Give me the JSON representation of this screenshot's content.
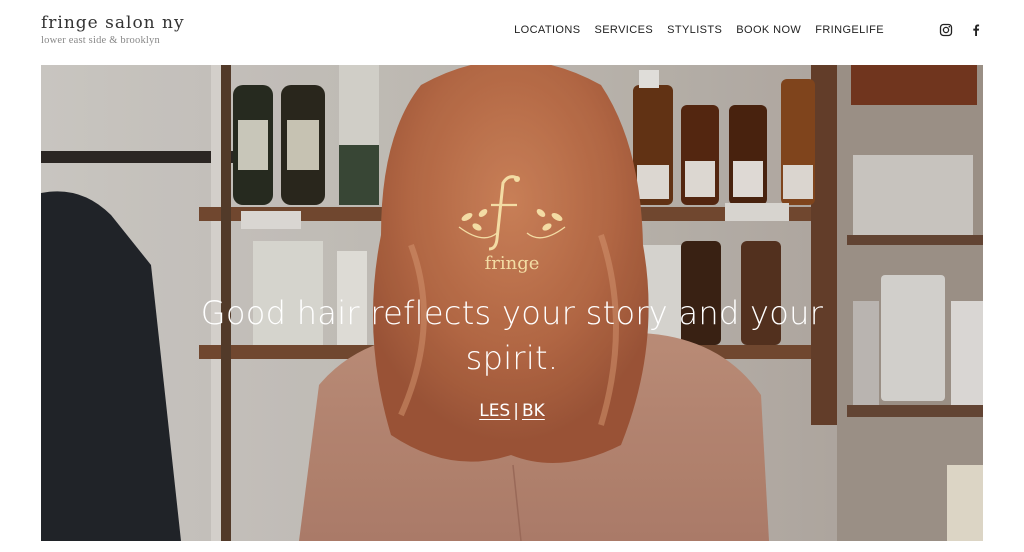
{
  "brand": {
    "title": "fringe salon ny",
    "subtitle": "lower east side & brooklyn"
  },
  "nav": {
    "items": [
      {
        "label": "LOCATIONS"
      },
      {
        "label": "SERVICES"
      },
      {
        "label": "STYLISTS"
      },
      {
        "label": "BOOK NOW"
      },
      {
        "label": "FRINGELIFE"
      }
    ]
  },
  "social": {
    "icons": [
      "instagram-icon",
      "facebook-icon"
    ]
  },
  "hero": {
    "logo_text": "fringe",
    "tagline_line1": "Good hair reflects your story and your",
    "tagline_line2": "spirit.",
    "location_les": "LES",
    "separator": "|",
    "location_bk": "BK"
  },
  "colors": {
    "logo_gold": "#f3dca4",
    "text_dark": "#222222",
    "hero_text": "#ffffff"
  }
}
